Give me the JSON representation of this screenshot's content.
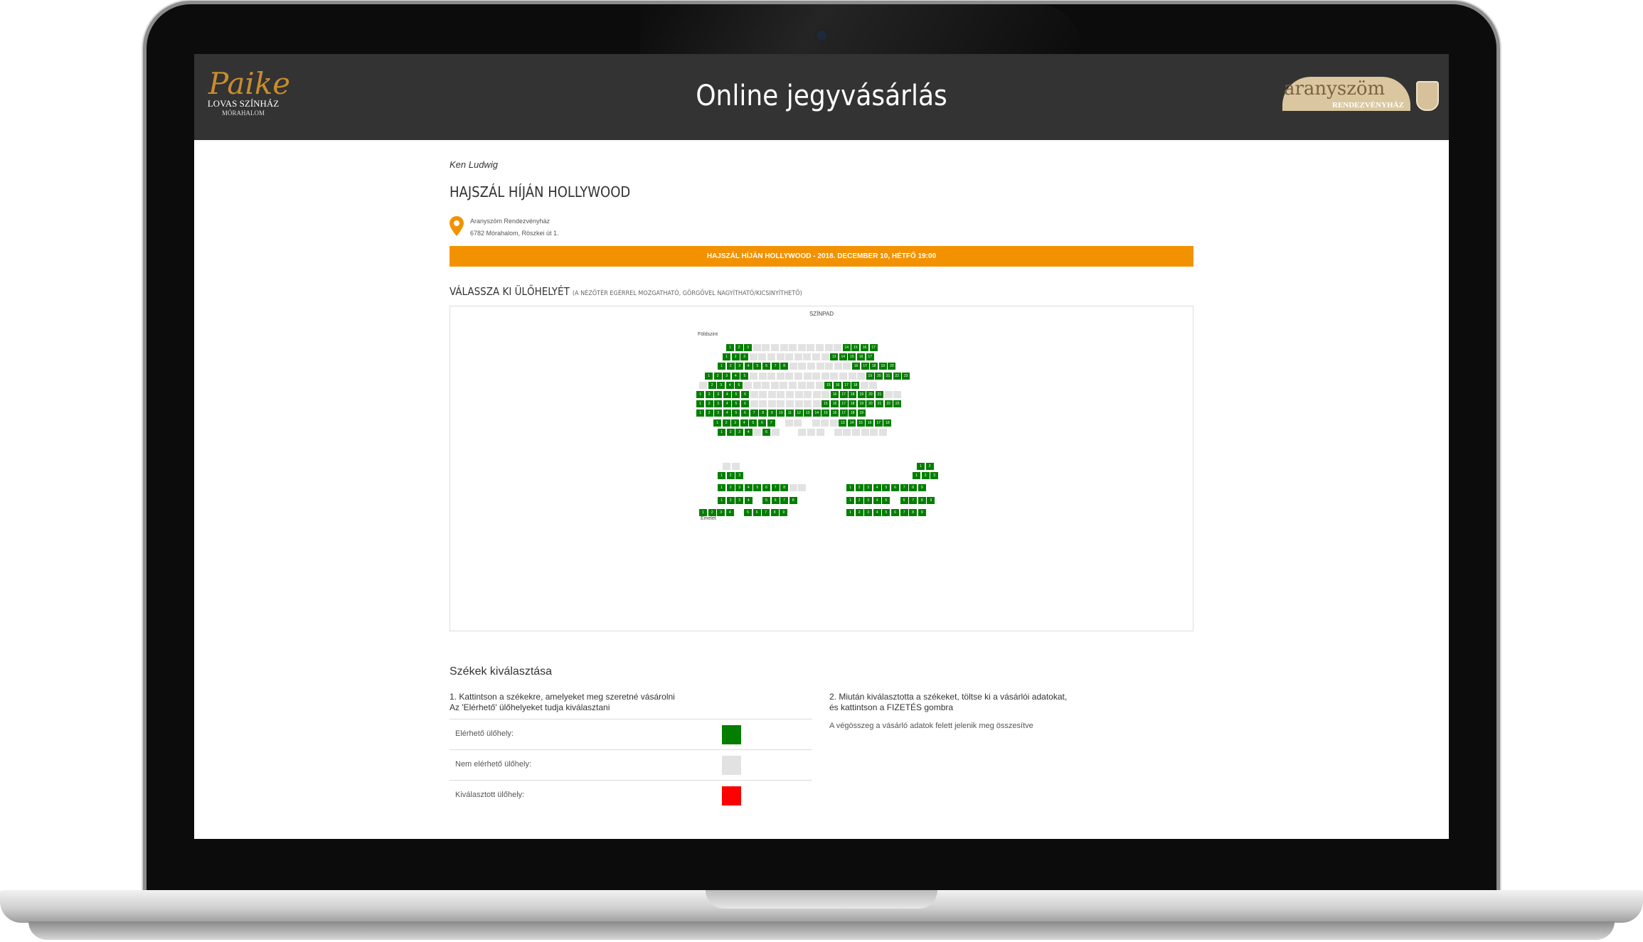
{
  "header": {
    "title": "Online jegyvásárlás",
    "left_logo": {
      "line1": "Paike",
      "line2": "LOVAS SZÍNHÁZ",
      "line3": "MÓRAHALOM"
    },
    "right_logo": {
      "line1": "aranyszöm",
      "line2": "RENDEZVÉNYHÁZ"
    }
  },
  "event": {
    "author": "Ken Ludwig",
    "title": "HAJSZÁL HÍJÁN HOLLYWOOD",
    "venue_name": "Aranyszöm Rendezvényház",
    "venue_address": "6782 Mórahalom, Röszkei út 1.",
    "banner": "HAJSZÁL HÍJÁN HOLLYWOOD - 2018. DECEMBER 10, HÉTFŐ 19:00",
    "location_icon": "map-pin-icon"
  },
  "seatmap": {
    "heading": "VÁLASSZA KI ÜLŐHELYÉT",
    "heading_note": "(A NÉZŐTÉR EGÉRREL MOZGATHATÓ, GÖRGŐVEL NAGYÍTHATÓ/KICSINYÍTHETŐ)",
    "stage_label": "SZÍNPAD",
    "ground_label": "Földszint",
    "balcony_label": "Emelet",
    "colors": {
      "available": "#037e00",
      "unavailable": "#e2e2e2",
      "selected": "#ff0000"
    }
  },
  "instructions": {
    "title": "Székek kiválasztása",
    "step1_line1": "1. Kattintson a székekre, amelyeket meg szeretné vásárolni",
    "step1_line2": "Az 'Elérhető' ülőhelyeket tudja kiválasztani",
    "step2_line1": "2. Miután kiválasztotta a székeket, töltse ki a vásárlói adatokat,",
    "step2_line2": "és kattintson a FIZETÉS gombra",
    "step2_note": "A végösszeg a vásárló adatok felett jelenik meg összesítve",
    "legend": [
      {
        "label": "Elérhető ülőhely:",
        "color": "#037e00"
      },
      {
        "label": "Nem elérhető ülőhely:",
        "color": "#e2e2e2"
      },
      {
        "label": "Kiválasztott ülőhely:",
        "color": "#ff0000"
      }
    ]
  }
}
